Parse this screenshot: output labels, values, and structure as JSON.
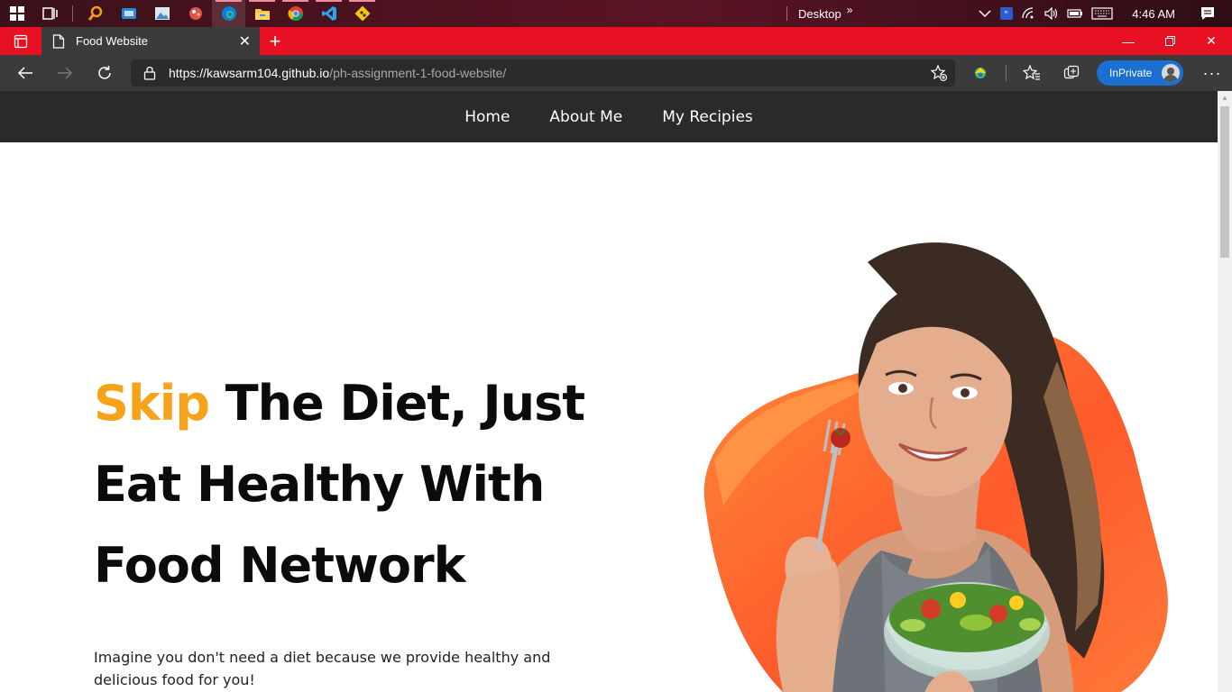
{
  "taskbar": {
    "desktop_label": "Desktop",
    "clock": "4:46 AM"
  },
  "browser": {
    "tab_title": "Food Website",
    "url_host": "https://kawsarm104.github.io",
    "url_path": "/ph-assignment-1-food-website/",
    "inprivate_label": "InPrivate",
    "theme_color": "#e81123"
  },
  "site": {
    "nav": [
      "Home",
      "About Me",
      "My Recipies"
    ],
    "hero": {
      "title_accent": "Skip",
      "title_line1_rest": " The Diet, Just",
      "title_line2": "Eat Healthy With",
      "title_line3": "Food Network",
      "description": "Imagine you don't need a diet because we provide healthy and delicious food for you!",
      "accent_color": "#f7a21b",
      "shape_color": "#fe5a2a"
    }
  }
}
